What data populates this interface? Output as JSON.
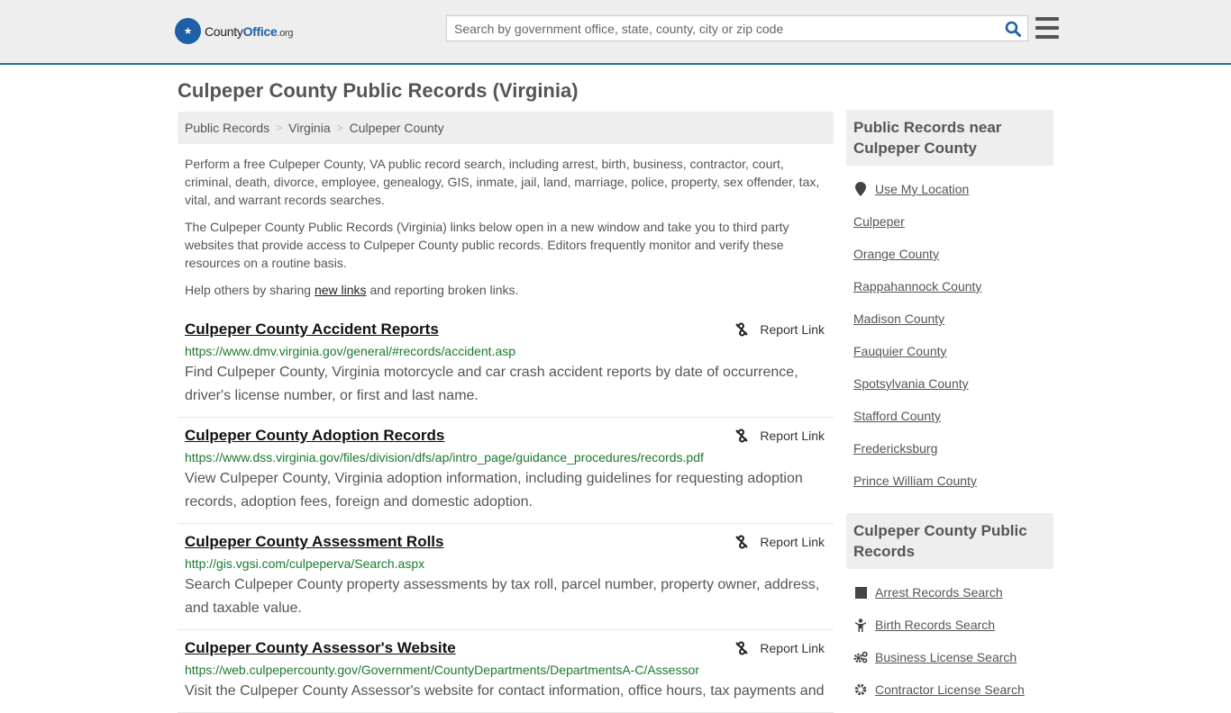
{
  "header": {
    "logo": {
      "county": "County",
      "office": "Office",
      "org": ".org"
    },
    "search_placeholder": "Search by government office, state, county, city or zip code",
    "search_value": ""
  },
  "page_title": "Culpeper County Public Records (Virginia)",
  "breadcrumb": [
    "Public Records",
    "Virginia",
    "Culpeper County"
  ],
  "intro": {
    "p1": "Perform a free Culpeper County, VA public record search, including arrest, birth, business, contractor, court, criminal, death, divorce, employee, genealogy, GIS, inmate, jail, land, marriage, police, property, sex offender, tax, vital, and warrant records searches.",
    "p2": "The Culpeper County Public Records (Virginia) links below open in a new window and take you to third party websites that provide access to Culpeper County public records. Editors frequently monitor and verify these resources on a routine basis.",
    "p3_before": "Help others by sharing ",
    "p3_link": "new links",
    "p3_after": " and reporting broken links."
  },
  "report_label": "Report Link",
  "records": [
    {
      "title": "Culpeper County Accident Reports",
      "url": "https://www.dmv.virginia.gov/general/#records/accident.asp",
      "desc": "Find Culpeper County, Virginia motorcycle and car crash accident reports by date of occurrence, driver's license number, or first and last name."
    },
    {
      "title": "Culpeper County Adoption Records",
      "url": "https://www.dss.virginia.gov/files/division/dfs/ap/intro_page/guidance_procedures/records.pdf",
      "desc": "View Culpeper County, Virginia adoption information, including guidelines for requesting adoption records, adoption fees, foreign and domestic adoption."
    },
    {
      "title": "Culpeper County Assessment Rolls",
      "url": "http://gis.vgsi.com/culpeperva/Search.aspx",
      "desc": "Search Culpeper County property assessments by tax roll, parcel number, property owner, address, and taxable value."
    },
    {
      "title": "Culpeper County Assessor's Website",
      "url": "https://web.culpepercounty.gov/Government/CountyDepartments/DepartmentsA-C/Assessor",
      "desc": "Visit the Culpeper County Assessor's website for contact information, office hours, tax payments and"
    }
  ],
  "sidebar": {
    "nearby_title": "Public Records near Culpeper County",
    "use_location": "Use My Location",
    "nearby": [
      "Culpeper",
      "Orange County",
      "Rappahannock County",
      "Madison County",
      "Fauquier County",
      "Spotsylvania County",
      "Stafford County",
      "Fredericksburg",
      "Prince William County"
    ],
    "records_title": "Culpeper County Public Records",
    "record_links": [
      {
        "label": "Arrest Records Search",
        "icon": "square-icon"
      },
      {
        "label": "Birth Records Search",
        "icon": "child-icon"
      },
      {
        "label": "Business License Search",
        "icon": "gears-icon"
      },
      {
        "label": "Contractor License Search",
        "icon": "gear-icon"
      }
    ]
  },
  "colors": {
    "brand": "#1f5fa8",
    "url_green": "#1a7a2e",
    "accent_border": "#2b6cb0"
  }
}
